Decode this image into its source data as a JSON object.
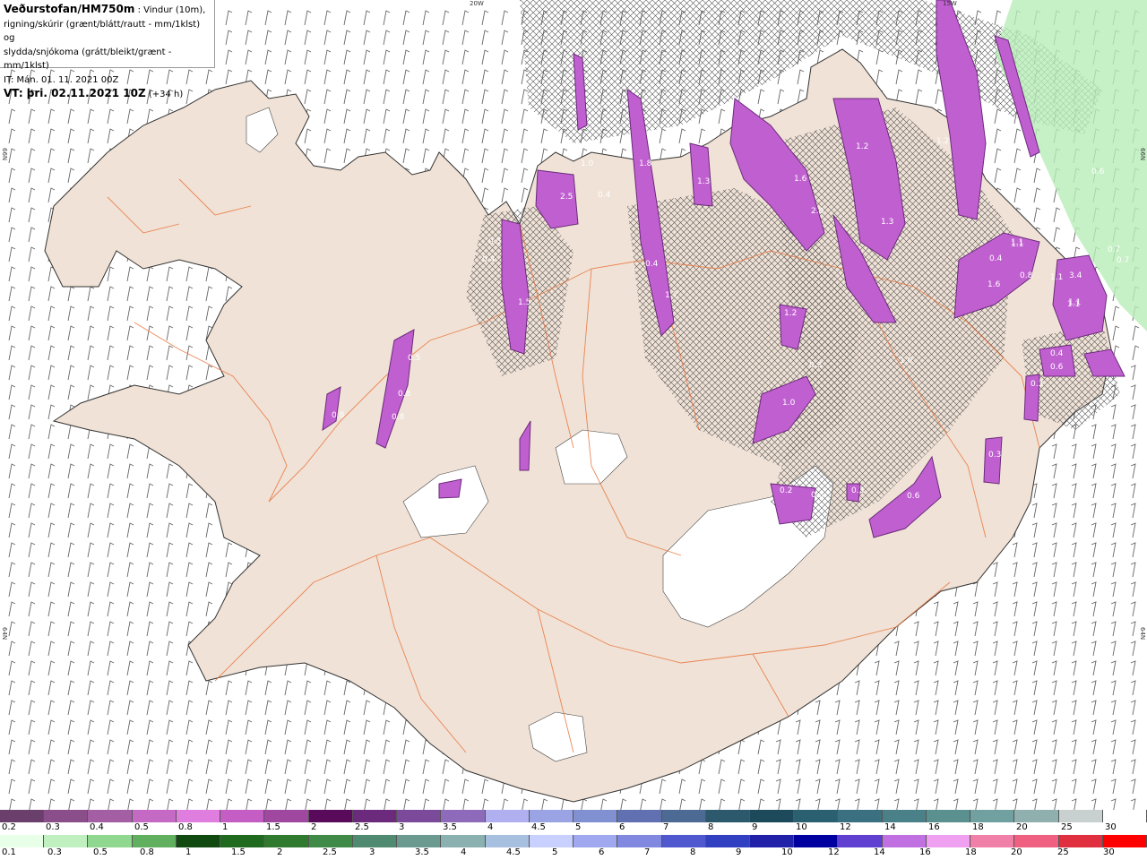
{
  "header": {
    "title": "Veðurstofan/HM750m",
    "title_suffix": " : Vindur (10m),",
    "line2": "rigning/skúrir (grænt/blátt/rautt - mm/1klst) og",
    "line3": "slydda/snjókoma (grátt/bleikt/grænt - mm/1klst)",
    "it_line": "IT: Mán. 01. 11. 2021 00Z",
    "vt_label": "VT:",
    "vt_value": " þri. 02.11.2021 10Z",
    "vt_offset": " (+34 h)"
  },
  "graticule": {
    "lon_top": [
      "20W",
      "15W"
    ],
    "lat_left": [
      "66N",
      "64N"
    ],
    "lat_right": [
      "66N",
      "64N"
    ]
  },
  "map_labels": [
    "1.0",
    "2.5",
    "0.4",
    "1.8",
    "1.3",
    "1.1",
    "0.5",
    "0.4",
    "1.5",
    "0.4",
    "1.7",
    "1.2",
    "1.2",
    "1.3",
    "2.0",
    "1.6",
    "1.1",
    "0.8",
    "0.4",
    "0.6",
    "1.6",
    "1.1",
    "3.4",
    "1.1",
    "0.4",
    "0.6",
    "1.2",
    "0.3",
    "0.5",
    "1.0",
    "0.8",
    "0.8",
    "0.8",
    "1.0",
    "0.2",
    "0.3",
    "0.3",
    "0.6",
    "0.3",
    "0.3",
    "1.1",
    "0.7",
    "0.7"
  ],
  "legend_snow": {
    "labels": [
      "0.2",
      "0.3",
      "0.4",
      "0.5",
      "0.8",
      "1",
      "1.5",
      "2",
      "2.5",
      "3",
      "3.5",
      "4",
      "4.5",
      "5",
      "6",
      "7",
      "8",
      "9",
      "10",
      "12",
      "14",
      "16",
      "18",
      "20",
      "25",
      "30"
    ],
    "colors": [
      "#6b3f6b",
      "#8a4f8a",
      "#a45fa4",
      "#c46ac4",
      "#e07ee0",
      "#c45ec4",
      "#a048a0",
      "#5a0a5a",
      "#6b2a7b",
      "#7b4a9b",
      "#8e6abb",
      "#b0b0f0",
      "#9aa4e4",
      "#8090d0",
      "#6070b0",
      "#4c6a94",
      "#2c5a6c",
      "#1c4a5a",
      "#2a6070",
      "#3a7080",
      "#4a8088",
      "#5a9090",
      "#70a0a0",
      "#90b0b0",
      "#c8d0d0",
      "#ffffff"
    ]
  },
  "legend_rain": {
    "labels": [
      "0.1",
      "0.3",
      "0.5",
      "0.8",
      "1",
      "1.5",
      "2",
      "2.5",
      "3",
      "3.5",
      "4",
      "4.5",
      "5",
      "6",
      "7",
      "8",
      "9",
      "10",
      "12",
      "14",
      "16",
      "18",
      "20",
      "25",
      "30"
    ],
    "colors": [
      "#e8ffe8",
      "#c0f0c0",
      "#90d890",
      "#60b060",
      "#104a10",
      "#206a20",
      "#307a30",
      "#408a48",
      "#508a70",
      "#6a9a90",
      "#8ab0b0",
      "#a8c0e0",
      "#c8d0ff",
      "#a0a8f0",
      "#8088e0",
      "#5058d0",
      "#3040c0",
      "#2020a8",
      "#0000a0",
      "#6040d0",
      "#c070e0",
      "#f0a0f0",
      "#f080a8",
      "#f06080",
      "#e03040",
      "#ff0000"
    ]
  },
  "colors": {
    "land": "#f0e2d6",
    "roads": "#e8743c",
    "glacier": "#ffffff",
    "sea": "#ffffff"
  }
}
